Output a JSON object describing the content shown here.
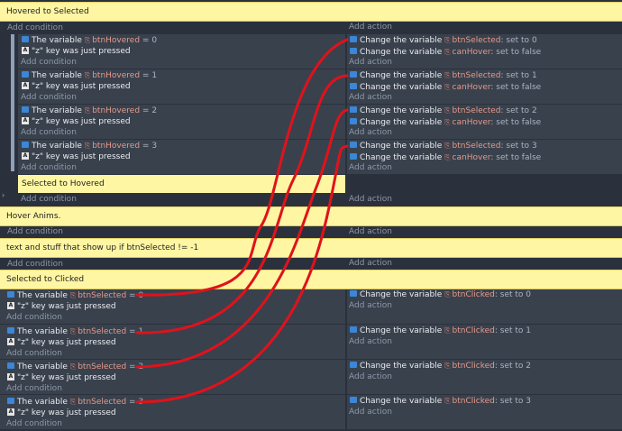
{
  "groups": {
    "hovered_to_selected": "Hovered to Selected",
    "selected_to_hovered": "Selected to Hovered",
    "hover_anims": "Hover Anims.",
    "text_stuff": "text and stuff that show up if btnSelected != -1",
    "selected_to_clicked": "Selected to Clicked"
  },
  "labels": {
    "add_condition": "Add condition",
    "add_action": "Add action",
    "the_variable": "The variable",
    "change_the_variable": "Change the variable",
    "key_pressed": "\"z\" key was just pressed",
    "set_to": ": set to",
    "set_to_false": ": set to false"
  },
  "hover_events": [
    {
      "cond_var": "btnHovered",
      "cond_op": "= 0",
      "act1_var": "btnSelected",
      "act1_val": "0",
      "act2_var": "canHover"
    },
    {
      "cond_var": "btnHovered",
      "cond_op": "= 1",
      "act1_var": "btnSelected",
      "act1_val": "1",
      "act2_var": "canHover"
    },
    {
      "cond_var": "btnHovered",
      "cond_op": "= 2",
      "act1_var": "btnSelected",
      "act1_val": "2",
      "act2_var": "canHover"
    },
    {
      "cond_var": "btnHovered",
      "cond_op": "= 3",
      "act1_var": "btnSelected",
      "act1_val": "3",
      "act2_var": "canHover"
    }
  ],
  "click_events": [
    {
      "cond_var": "btnSelected",
      "cond_op": "= 0",
      "act_var": "btnClicked",
      "act_val": "0"
    },
    {
      "cond_var": "btnSelected",
      "cond_op": "= 1",
      "act_var": "btnClicked",
      "act_val": "1"
    },
    {
      "cond_var": "btnSelected",
      "cond_op": "= 2",
      "act_var": "btnClicked",
      "act_val": "2"
    },
    {
      "cond_var": "btnSelected",
      "cond_op": "= 3",
      "act_var": "btnClicked",
      "act_val": "3"
    }
  ],
  "colors": {
    "group_bg": "#fff6a3",
    "event_bg": "#39414d",
    "annotation": "#e0121b",
    "var_icon": "#3b86d6"
  }
}
